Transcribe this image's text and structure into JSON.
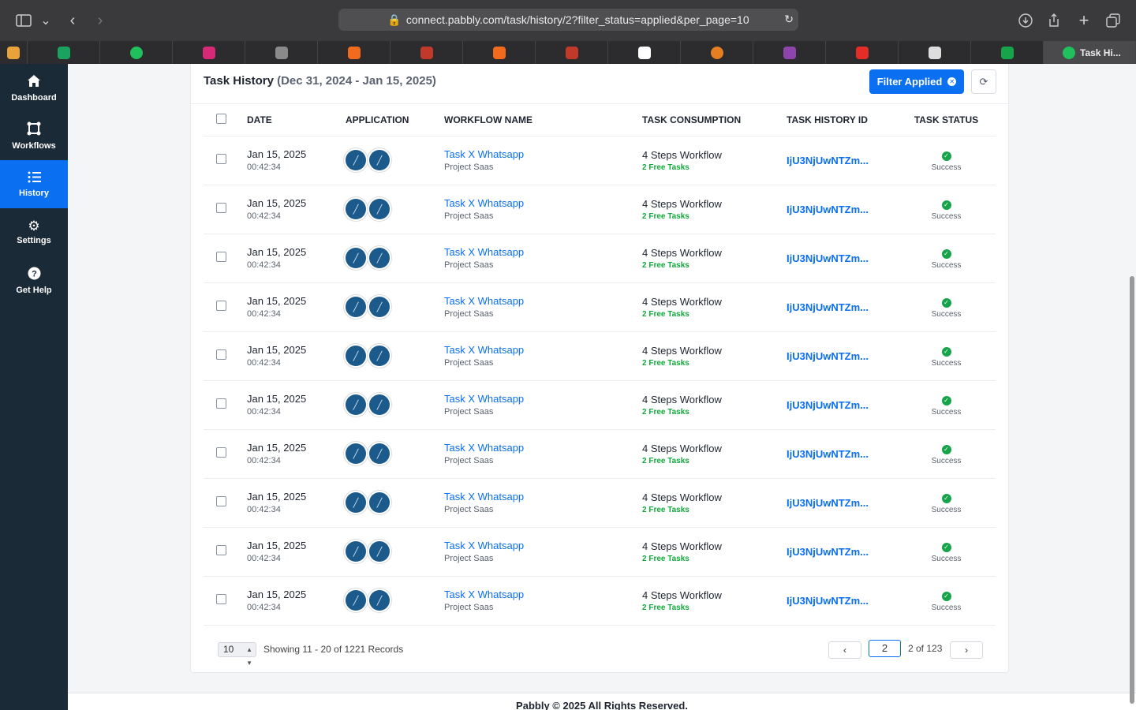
{
  "browser": {
    "url": "connect.pabbly.com/task/history/2?filter_status=applied&per_page=10",
    "active_tab": "Task Hi..."
  },
  "sidebar": {
    "items": [
      {
        "label": "Dashboard",
        "icon": "home-icon"
      },
      {
        "label": "Workflows",
        "icon": "workflow-icon"
      },
      {
        "label": "History",
        "icon": "history-icon",
        "active": true
      },
      {
        "label": "Settings",
        "icon": "gear-icon"
      },
      {
        "label": "Get Help",
        "icon": "help-icon"
      }
    ]
  },
  "header": {
    "title": "Task History",
    "date_range": "(Dec 31, 2024 - Jan 15, 2025)",
    "filter_label": "Filter Applied"
  },
  "table": {
    "columns": [
      "DATE",
      "APPLICATION",
      "WORKFLOW NAME",
      "TASK CONSUMPTION",
      "TASK HISTORY ID",
      "TASK STATUS"
    ],
    "rows": [
      {
        "date": "Jan 15, 2025",
        "time": "00:42:34",
        "workflow": "Task X Whatsapp",
        "project": "Project Saas",
        "consumption": "4 Steps Workflow",
        "free_tasks": "2 Free Tasks",
        "history_id": "IjU3NjUwNTZm...",
        "status": "Success"
      },
      {
        "date": "Jan 15, 2025",
        "time": "00:42:34",
        "workflow": "Task X Whatsapp",
        "project": "Project Saas",
        "consumption": "4 Steps Workflow",
        "free_tasks": "2 Free Tasks",
        "history_id": "IjU3NjUwNTZm...",
        "status": "Success"
      },
      {
        "date": "Jan 15, 2025",
        "time": "00:42:34",
        "workflow": "Task X Whatsapp",
        "project": "Project Saas",
        "consumption": "4 Steps Workflow",
        "free_tasks": "2 Free Tasks",
        "history_id": "IjU3NjUwNTZm...",
        "status": "Success"
      },
      {
        "date": "Jan 15, 2025",
        "time": "00:42:34",
        "workflow": "Task X Whatsapp",
        "project": "Project Saas",
        "consumption": "4 Steps Workflow",
        "free_tasks": "2 Free Tasks",
        "history_id": "IjU3NjUwNTZm...",
        "status": "Success"
      },
      {
        "date": "Jan 15, 2025",
        "time": "00:42:34",
        "workflow": "Task X Whatsapp",
        "project": "Project Saas",
        "consumption": "4 Steps Workflow",
        "free_tasks": "2 Free Tasks",
        "history_id": "IjU3NjUwNTZm...",
        "status": "Success"
      },
      {
        "date": "Jan 15, 2025",
        "time": "00:42:34",
        "workflow": "Task X Whatsapp",
        "project": "Project Saas",
        "consumption": "4 Steps Workflow",
        "free_tasks": "2 Free Tasks",
        "history_id": "IjU3NjUwNTZm...",
        "status": "Success"
      },
      {
        "date": "Jan 15, 2025",
        "time": "00:42:34",
        "workflow": "Task X Whatsapp",
        "project": "Project Saas",
        "consumption": "4 Steps Workflow",
        "free_tasks": "2 Free Tasks",
        "history_id": "IjU3NjUwNTZm...",
        "status": "Success"
      },
      {
        "date": "Jan 15, 2025",
        "time": "00:42:34",
        "workflow": "Task X Whatsapp",
        "project": "Project Saas",
        "consumption": "4 Steps Workflow",
        "free_tasks": "2 Free Tasks",
        "history_id": "IjU3NjUwNTZm...",
        "status": "Success"
      },
      {
        "date": "Jan 15, 2025",
        "time": "00:42:34",
        "workflow": "Task X Whatsapp",
        "project": "Project Saas",
        "consumption": "4 Steps Workflow",
        "free_tasks": "2 Free Tasks",
        "history_id": "IjU3NjUwNTZm...",
        "status": "Success"
      },
      {
        "date": "Jan 15, 2025",
        "time": "00:42:34",
        "workflow": "Task X Whatsapp",
        "project": "Project Saas",
        "consumption": "4 Steps Workflow",
        "free_tasks": "2 Free Tasks",
        "history_id": "IjU3NjUwNTZm...",
        "status": "Success"
      }
    ]
  },
  "pagination": {
    "per_page": "10",
    "showing": "Showing 11 - 20 of 1221 Records",
    "current_page": "2",
    "of_pages": "2 of 123"
  },
  "footer": {
    "text": "Pabbly © 2025 All Rights Reserved."
  },
  "colors": {
    "primary": "#0a6ff0",
    "sidebar_bg": "#1b2a37",
    "success": "#16a34a",
    "free_tasks": "#11a83b"
  }
}
